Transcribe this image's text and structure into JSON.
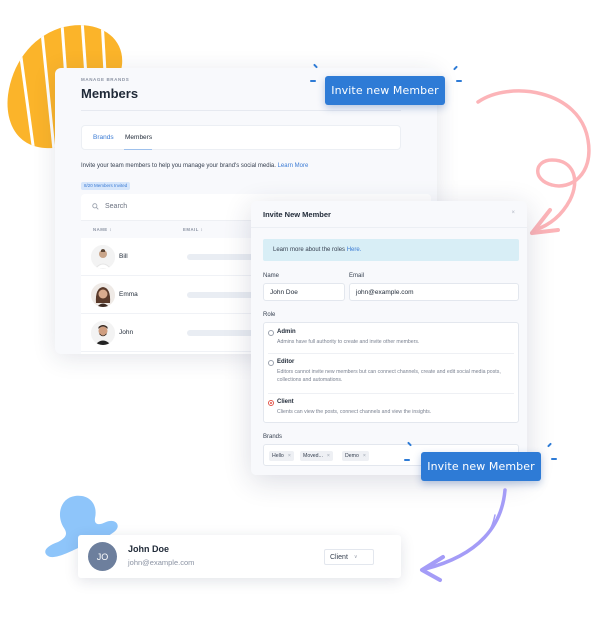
{
  "panel": {
    "eyebrow": "MANAGE BRANDS",
    "title": "Members",
    "tabs": [
      {
        "label": "Brands",
        "active": false
      },
      {
        "label": "Members",
        "active": true
      }
    ],
    "intro_text": "Invite your team members to help you manage your brand's social media.",
    "intro_link": "Learn More",
    "badge": "8/20 Members Invited",
    "search_placeholder": "Search",
    "columns": [
      "NAME ↕",
      "EMAIL ↕"
    ],
    "rows": [
      {
        "name": "Bill"
      },
      {
        "name": "Emma"
      },
      {
        "name": "John"
      }
    ]
  },
  "invite_button_label": "Invite new Member",
  "modal": {
    "title": "Invite New Member",
    "close": "×",
    "info_text": "Learn more about the roles",
    "info_link": "Here.",
    "name_label": "Name",
    "name_value": "John Doe",
    "email_label": "Email",
    "email_value": "john@example.com",
    "role_label": "Role",
    "roles": [
      {
        "name": "Admin",
        "desc": "Admins have full authority to create and invite other members.",
        "selected": false
      },
      {
        "name": "Editor",
        "desc": "Editors cannot invite new members but can connect channels, create and edit social media posts, collections and automations.",
        "selected": false
      },
      {
        "name": "Client",
        "desc": "Clients can view the posts, connect channels and view the insights.",
        "selected": true
      }
    ],
    "brands_label": "Brands",
    "brands": [
      "Hello",
      "Moved...",
      "Demo"
    ],
    "chip_remove": "×"
  },
  "member_card": {
    "initials": "JO",
    "name": "John Doe",
    "email": "john@example.com",
    "role": "Client",
    "chevron": "∨"
  },
  "colors": {
    "accent": "#2e7bd6",
    "link": "#3b7bd4",
    "selected_radio": "#e2574c",
    "deco_yellow": "#fbb42a",
    "deco_blue": "#8ec5fa",
    "arrow_pink": "#fcb4b8",
    "arrow_purple": "#a49cf7"
  }
}
